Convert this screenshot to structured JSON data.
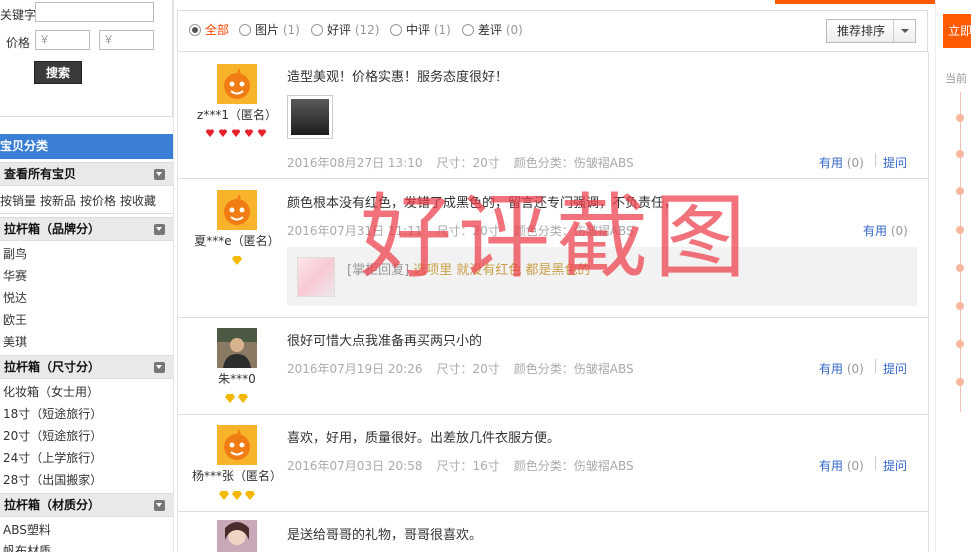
{
  "sidebar": {
    "keyword_label": "关键字",
    "price_label": "价格",
    "price_min_placeholder": "￥",
    "price_max_placeholder": "￥",
    "search_button": "搜索",
    "category_header": "宝贝分类",
    "all_items": "查看所有宝贝",
    "sort_links": [
      "按销量",
      "按新品",
      "按价格",
      "按收藏"
    ],
    "groups": [
      {
        "title": "拉杆箱（品牌分）",
        "items": [
          "副鸟",
          "华赛",
          "悦达",
          "欧王",
          "美琪"
        ]
      },
      {
        "title": "拉杆箱（尺寸分）",
        "items": [
          "化妆箱（女士用）",
          "18寸（短途旅行）",
          "20寸（短途旅行）",
          "24寸（上学旅行）",
          "28寸（出国搬家）"
        ]
      },
      {
        "title": "拉杆箱（材质分）",
        "items": [
          "ABS塑料",
          "帆布材质"
        ]
      }
    ]
  },
  "filter": {
    "options": [
      {
        "label": "全部",
        "count": ""
      },
      {
        "label": "图片",
        "count": "(1)"
      },
      {
        "label": "好评",
        "count": "(12)"
      },
      {
        "label": "中评",
        "count": "(1)"
      },
      {
        "label": "差评",
        "count": "(0)"
      }
    ],
    "sort_label": "推荐排序"
  },
  "reviews": [
    {
      "text": "造型美观！价格实惠！服务态度很好！",
      "user": "z***1（匿名）",
      "date": "2016年08月27日 13:10",
      "size": "尺寸：20寸",
      "color": "颜色分类：伤皱褶ABS",
      "useful": "有用",
      "useful_count": "(0)",
      "ask": "提问"
    },
    {
      "text": "颜色根本没有红色，发错了成黑色的，留言还专门强调，不负责任，",
      "user": "夏***e（匿名）",
      "date": "2016年07月31日 11:11",
      "size": "尺寸：20寸",
      "color": "颜色分类：伤皱褶ABS",
      "useful": "有用",
      "useful_count": "(0)",
      "reply_prefix": "[掌柜回复]",
      "reply_text": "选项里 就没有红色 都是黑色的"
    },
    {
      "text": "很好可惜大点我准备再买两只小的",
      "user": "朱***0",
      "date": "2016年07月19日 20:26",
      "size": "尺寸：20寸",
      "color": "颜色分类：伤皱褶ABS",
      "useful": "有用",
      "useful_count": "(0)",
      "ask": "提问"
    },
    {
      "text": "喜欢，好用，质量很好。出差放几件衣服方便。",
      "user": "杨***张（匿名）",
      "date": "2016年07月03日 20:58",
      "size": "尺寸：16寸",
      "color": "颜色分类：伤皱褶ABS",
      "useful": "有用",
      "useful_count": "(0)",
      "ask": "提问"
    },
    {
      "text": "是送给哥哥的礼物，哥哥很喜欢。"
    }
  ],
  "watermark": "好评截图",
  "right_panel": {
    "buy_label": "立即",
    "current_label": "当前"
  },
  "colors": {
    "accent": "#ff5a00",
    "category_header": "#3a7fd5",
    "link": "#3366cc",
    "selected_filter": "#ff4400",
    "watermark": "#eb3c46"
  }
}
